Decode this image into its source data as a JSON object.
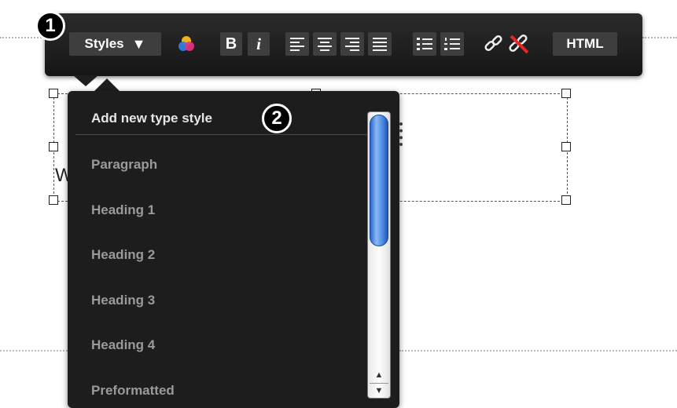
{
  "toolbar": {
    "styles_label": "Styles",
    "styles_caret": "▼",
    "bold_label": "B",
    "italic_label": "i",
    "html_label": "HTML"
  },
  "callouts": {
    "first": "1",
    "second": "2"
  },
  "background_text": {
    "fragment": "W"
  },
  "dropdown": {
    "items": [
      "Add new type style",
      "Paragraph",
      "Heading 1",
      "Heading 2",
      "Heading 3",
      "Heading 4",
      "Preformatted"
    ]
  },
  "scrollbar": {
    "up_arrow": "▲",
    "down_arrow": "▼"
  },
  "colors": {
    "toolbar_bg": "#1e1e1e",
    "dropdown_bg": "#1d1d1d",
    "scroll_thumb": "#3a7be0"
  },
  "icons": [
    "color-palette-icon",
    "align-left-icon",
    "align-center-icon",
    "align-right-icon",
    "align-justify-icon",
    "bullet-list-icon",
    "numbered-list-icon",
    "link-icon",
    "unlink-icon"
  ]
}
